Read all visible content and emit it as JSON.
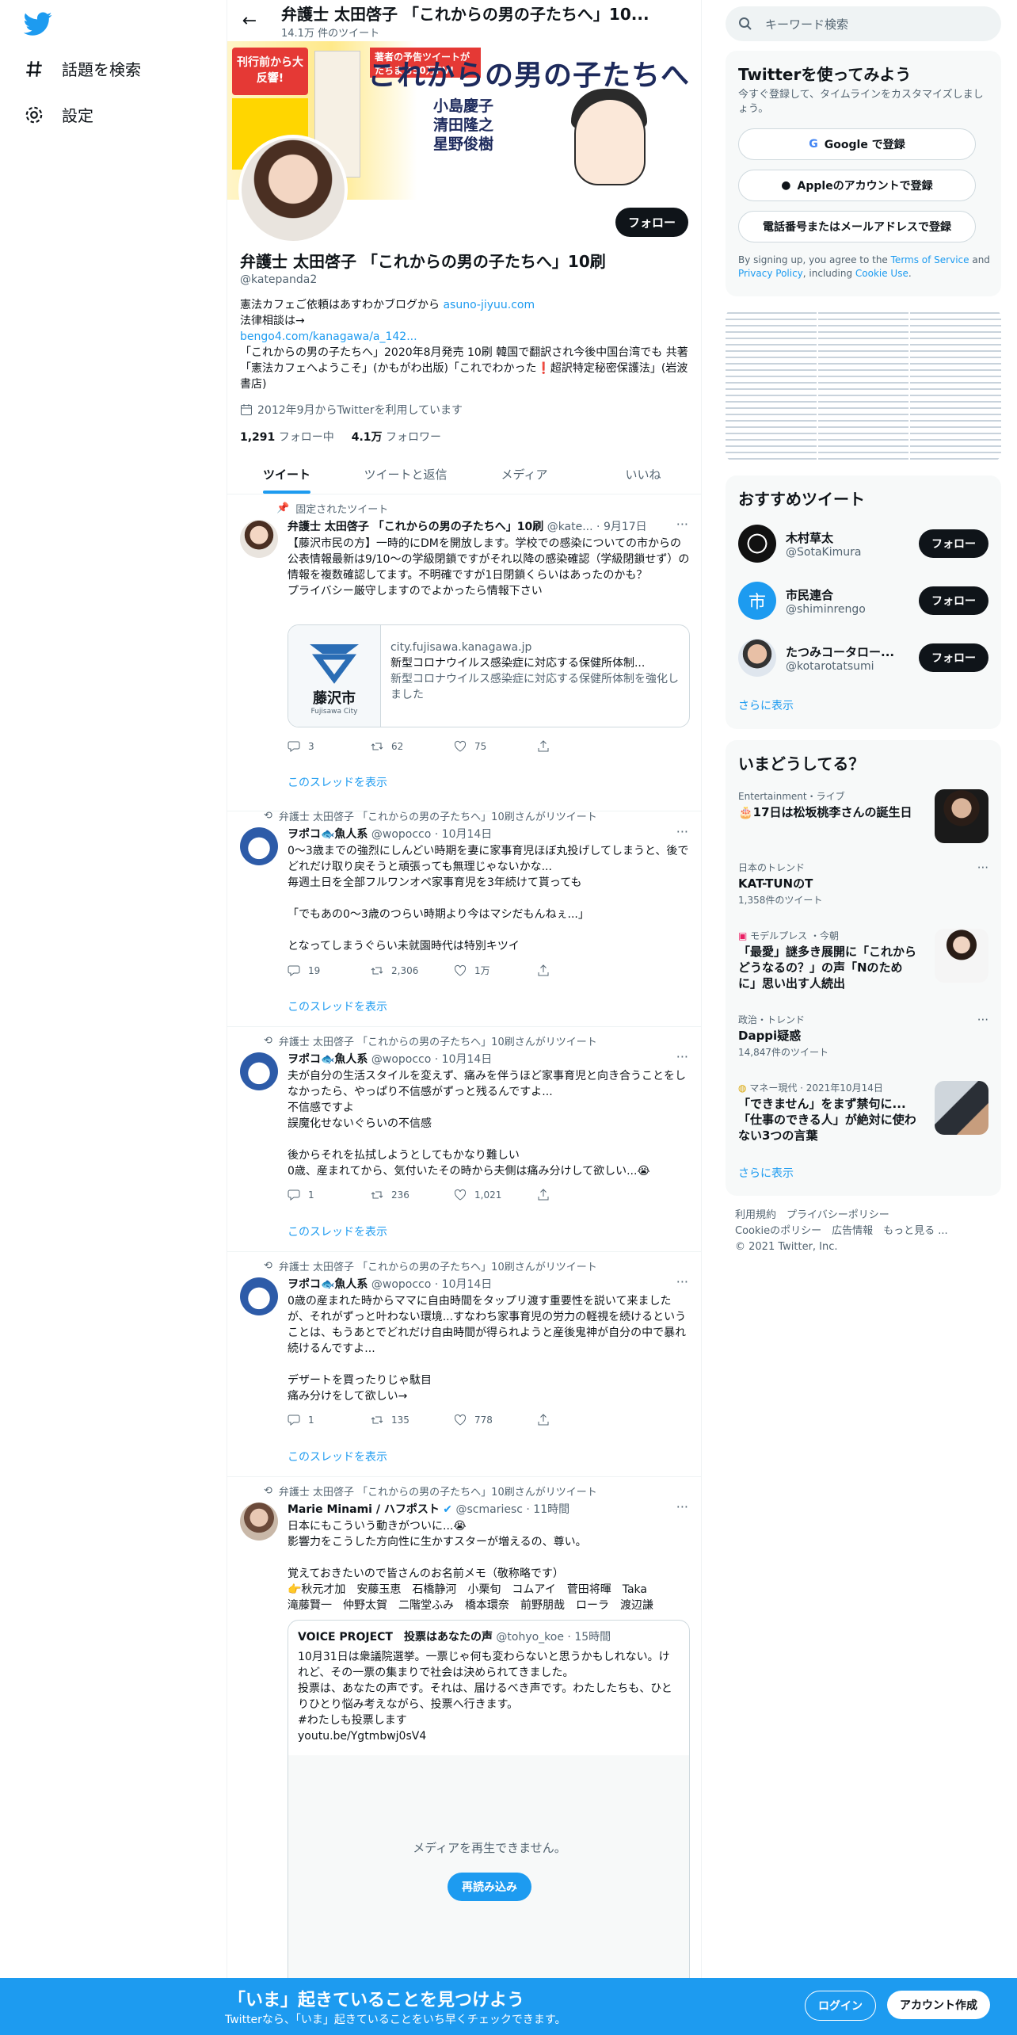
{
  "nav": {
    "explore_label": "話題を検索",
    "settings_label": "設定"
  },
  "topbar": {
    "title": "弁護士 太田啓子 「これからの男の子たちへ」10...",
    "tweet_count": "14.1万 件のツイート"
  },
  "banner": {
    "badge": "刊行前から大反響!",
    "promo": "著者の予告ツイートがたちまち50万PV!",
    "title": "これからの男の子たちへ",
    "names": "小島慶子\n清田隆之\n星野俊樹"
  },
  "profile": {
    "follow_label": "フォロー",
    "name": "弁護士 太田啓子 「これからの男の子たちへ」10刷",
    "handle": "@katepanda2",
    "bio_line1_prefix": "憲法カフェご依頼はあすわかブログから ",
    "bio_line1_link": "asuno-jiyuu.com",
    "bio_line2": "法律相談は→",
    "bio_link2": "bengo4.com/kanagawa/a_142...",
    "bio_rest": "「これからの男の子たちへ」2020年8月発売 10刷 韓国で翻訳され今後中国台湾でも 共著「憲法カフェへようこそ」(かもがわ出版)「これでわかった❗超訳特定秘密保護法」(岩波書店)",
    "joined": "2012年9月からTwitterを利用しています",
    "following_count": "1,291",
    "following_label": "フォロー中",
    "followers_count": "4.1万",
    "followers_label": "フォロワー"
  },
  "tabs": [
    "ツイート",
    "ツイートと返信",
    "メディア",
    "いいね"
  ],
  "tweets": [
    {
      "social": "固定されたツイート",
      "name": "弁護士 太田啓子 「これからの男の子たちへ」10刷",
      "handle": "@kate...",
      "date": "· 9月17日",
      "body": "【藤沢市民の方】一時的にDMを開放します。学校での感染についての市からの公表情報最新は9/10～の学級閉鎖ですがそれ以降の感染確認（学級閉鎖せず）の情報を複数確認してます。不明確ですが1日閉鎖くらいはあったのかも？\nプライバシー厳守しますのでよかったら情報下さい",
      "card_logo_text": "藤沢市",
      "card_logo_sub": "Fujisawa City",
      "card_domain": "city.fujisawa.kanagawa.jp",
      "card_title": "新型コロナウイルス感染症に対応する保健所体制...",
      "card_desc": "新型コロナウイルス感染症に対応する保健所体制を強化しました",
      "replies": "3",
      "retweets": "62",
      "likes": "75",
      "thread": "このスレッドを表示"
    },
    {
      "social": "弁護士 太田啓子 「これからの男の子たちへ」10刷さんがリツイート",
      "name": "ヲポコ🐟魚人系",
      "handle": "@wopocco",
      "date": "· 10月14日",
      "body": "0〜3歳までの強烈にしんどい時期を妻に家事育児ほぼ丸投げしてしまうと、後でどれだけ取り戻そうと頑張っても無理じゃないかな...\n毎週土日を全部フルワンオペ家事育児を3年続けて貰っても\n\n「でもあの0〜3歳のつらい時期より今はマシだもんねぇ...」\n\nとなってしまうぐらい未就園時代は特別キツイ",
      "replies": "19",
      "retweets": "2,306",
      "likes": "1万",
      "thread": "このスレッドを表示"
    },
    {
      "social": "弁護士 太田啓子 「これからの男の子たちへ」10刷さんがリツイート",
      "name": "ヲポコ🐟魚人系",
      "handle": "@wopocco",
      "date": "· 10月14日",
      "body": "夫が自分の生活スタイルを変えず、痛みを伴うほど家事育児と向き合うことをしなかったら、やっぱり不信感がずっと残るんですよ...\n不信感ですよ\n誤魔化せないぐらいの不信感\n\n後からそれを払拭しようとしてもかなり難しい\n0歳、産まれてから、気付いたその時から夫側は痛み分けして欲しい...😭",
      "replies": "1",
      "retweets": "236",
      "likes": "1,021",
      "thread": "このスレッドを表示"
    },
    {
      "social": "弁護士 太田啓子 「これからの男の子たちへ」10刷さんがリツイート",
      "name": "ヲポコ🐟魚人系",
      "handle": "@wopocco",
      "date": "· 10月14日",
      "body": "0歳の産まれた時からママに自由時間をタップリ渡す重要性を説いて来ましたが、それがずっと叶わない環境...すなわち家事育児の労力の軽視を続けるということは、もうあとでどれだけ自由時間が得られようと産後鬼神が自分の中で暴れ続けるんですよ...\n\nデザートを買ったりじゃ駄目\n痛み分けをして欲しい→",
      "replies": "1",
      "retweets": "135",
      "likes": "778",
      "thread": "このスレッドを表示"
    },
    {
      "social": "弁護士 太田啓子 「これからの男の子たちへ」10刷さんがリツイート",
      "name": "Marie Minami / ハフポスト",
      "handle": "@scmariesc",
      "date": "· 11時間",
      "body": "日本にもこういう動きがついに...😭\n影響力をこうした方向性に生かすスターが増えるの、尊い。\n\n覚えておきたいので皆さんのお名前メモ（敬称略です）\n👉秋元才加　安藤玉恵　石橋静河　小栗旬　コムアイ　菅田将暉　Taka\n滝藤賢一　仲野太賀　二階堂ふみ　橋本環奈　前野朋哉　ローラ　渡辺謙",
      "quote_name": "VOICE PROJECT　投票はあなたの声",
      "quote_handle": "@tohyo_koe · 15時間",
      "quote_body": "10月31日は衆議院選挙。一票じゃ何も変わらないと思うかもしれない。けれど、その一票の集まりで社会は決められてきました。\n投票は、あなたの声です。それは、届けるべき声です。わたしたちも、ひとりひとり悩み考えながら、投票へ行きます。\n #わたしも投票します\nyoutu.be/Ygtmbwj0sV4",
      "media_msg": "メディアを再生できません。",
      "media_retry": "再読み込み"
    }
  ],
  "right": {
    "search_placeholder": "キーワード検索",
    "signup_title": "Twitterを使ってみよう",
    "signup_sub": "今すぐ登録して、タイムラインをカスタマイズしましょう。",
    "google_btn": "Google で登録",
    "apple_btn": "Appleのアカウントで登録",
    "phone_btn": "電話番号またはメールアドレスで登録",
    "terms_prefix": "By signing up, you agree to the ",
    "terms_link1": "Terms of Service",
    "terms_mid": " and ",
    "terms_link2": "Privacy Policy",
    "terms_mid2": ", including ",
    "terms_link3": "Cookie Use",
    "terms_end": ".",
    "who_title": "おすすめツイート",
    "who": [
      {
        "name": "木村草太",
        "handle": "@SotaKimura",
        "button": "フォロー"
      },
      {
        "name": "市民連合",
        "handle": "@shiminrengo",
        "button": "フォロー"
      },
      {
        "name": "たつみコータロー...",
        "handle": "@kotarotatsumi",
        "button": "フォロー"
      }
    ],
    "who_more": "さらに表示",
    "trends_title": "いまどうしてる？",
    "trends": [
      {
        "context": "Entertainment・ライブ",
        "title": "🎂17日は松坂桃李さんの誕生日",
        "count": ""
      },
      {
        "context": "日本のトレンド",
        "title": "KAT-TUNのT",
        "count": "1,358件のツイート"
      },
      {
        "context": "モデルプレス ・今朝",
        "title": "「最愛」謎多き展開に「これからどうなるの？」の声「Nのために」思い出す人続出",
        "count": ""
      },
      {
        "context": "政治・トレンド",
        "title": "Dappi疑惑",
        "count": "14,847件のツイート"
      },
      {
        "context": "マネー現代 · 2021年10月14日",
        "title": "「できません」をまず禁句に...「仕事のできる人」が絶対に使わない3つの言葉",
        "count": ""
      }
    ],
    "trends_more": "さらに表示",
    "footer_line1": "利用規約　プライバシーポリシー",
    "footer_line2": "Cookieのポリシー　広告情報　もっと見る ...",
    "footer_line3": "© 2021 Twitter, Inc."
  },
  "bottom": {
    "title": "「いま」起きていることを見つけよう",
    "sub": "Twitterなら、「いま」起きていることをいち早くチェックできます。",
    "login": "ログイン",
    "signup": "アカウント作成"
  },
  "colors": {
    "accent": "#1d9bf0",
    "text": "#0f1419",
    "muted": "#536471"
  }
}
